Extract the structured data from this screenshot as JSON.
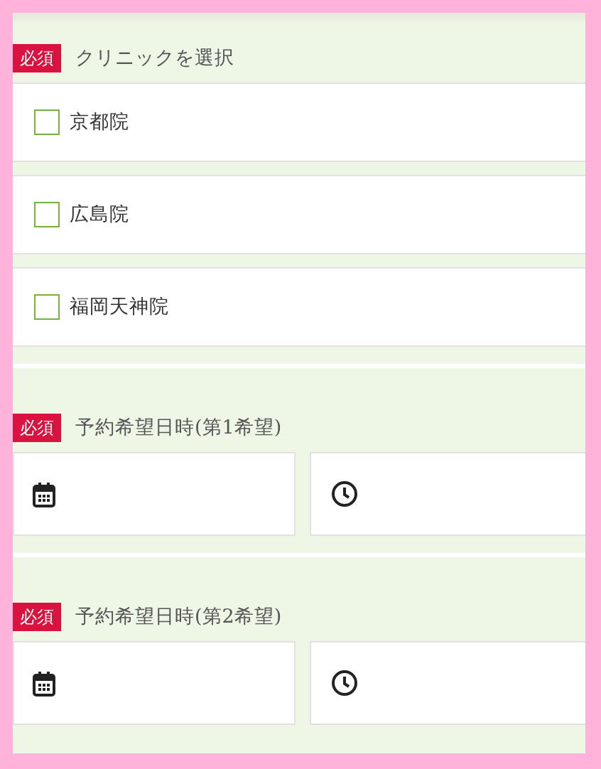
{
  "clinic_section": {
    "required_badge": "必須",
    "label": "クリニックを選択",
    "options": [
      {
        "label": "京都院",
        "checked": false
      },
      {
        "label": "広島院",
        "checked": false
      },
      {
        "label": "福岡天神院",
        "checked": false
      }
    ]
  },
  "preferences": [
    {
      "required_badge": "必須",
      "label": "予約希望日時(第1希望)"
    },
    {
      "required_badge": "必須",
      "label": "予約希望日時(第2希望)"
    }
  ]
}
